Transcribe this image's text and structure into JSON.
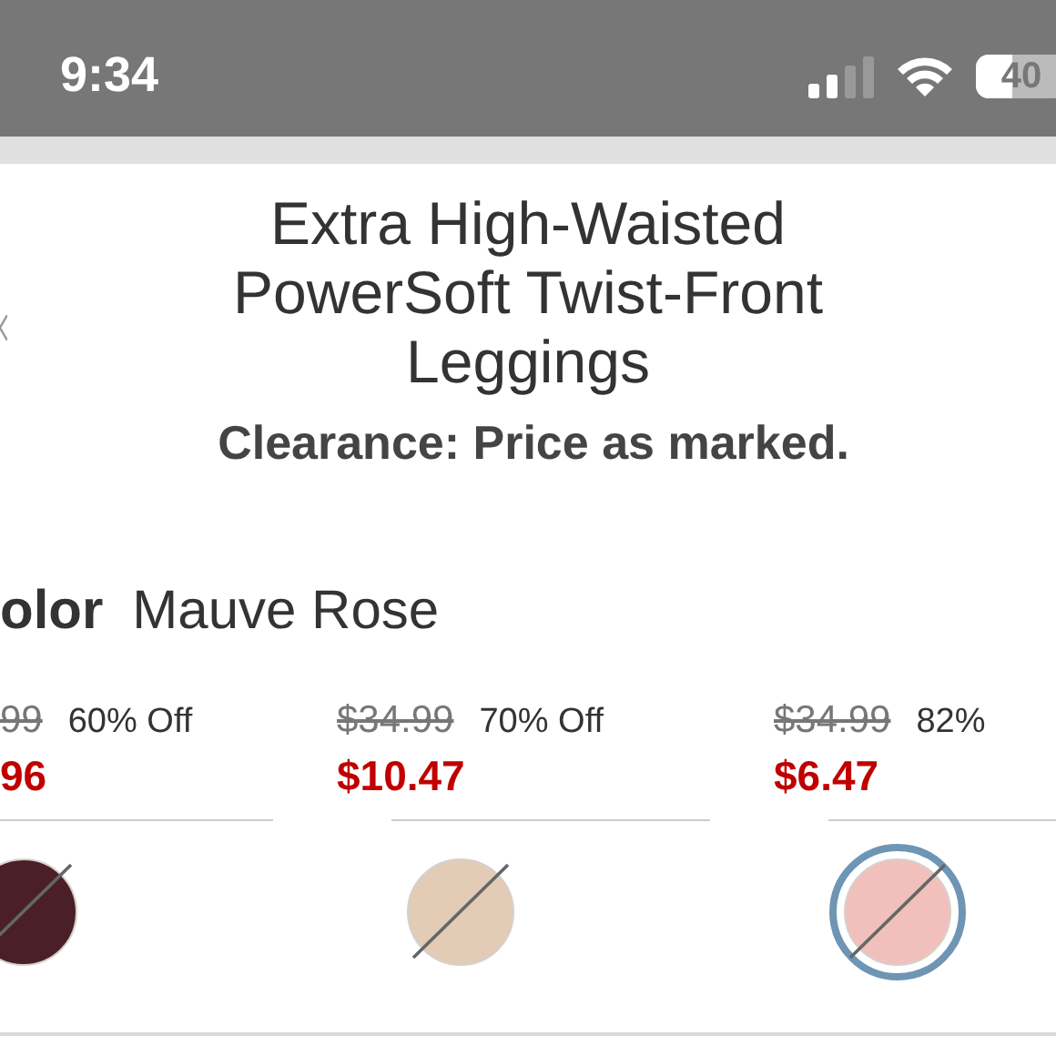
{
  "status_bar": {
    "time": "9:34",
    "battery": "40"
  },
  "product": {
    "title": "Extra High-Waisted PowerSoft Twist-Front Leggings",
    "note": "Clearance: Price as marked."
  },
  "color_picker": {
    "label": "olor",
    "value": "Mauve Rose"
  },
  "swatches": [
    {
      "original_price": "99",
      "discount": "60% Off",
      "price": "96",
      "color": "#4a1f28",
      "selected": false,
      "unavailable": true
    },
    {
      "original_price": "$34.99",
      "discount": "70% Off",
      "price": "$10.47",
      "color": "#e2ccb6",
      "selected": false,
      "unavailable": true
    },
    {
      "original_price": "$34.99",
      "discount": "82%",
      "price": "$6.47",
      "color": "#f2c0bc",
      "selected": true,
      "unavailable": true
    }
  ]
}
